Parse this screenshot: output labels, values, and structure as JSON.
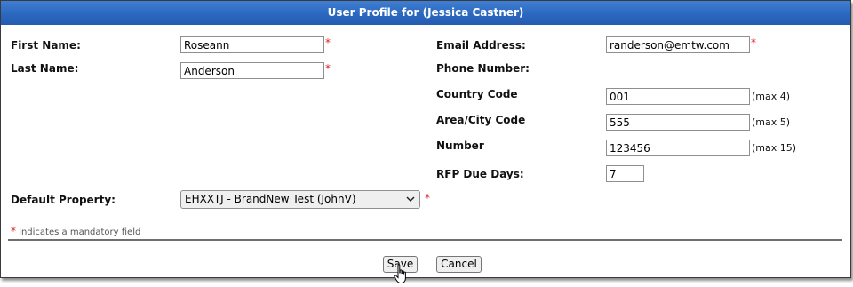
{
  "dialog": {
    "title": "User Profile for (Jessica Castner)"
  },
  "form": {
    "first_name": {
      "label": "First Name:",
      "value": "Roseann",
      "required_mark": "*"
    },
    "last_name": {
      "label": "Last Name:",
      "value": "Anderson",
      "required_mark": "*"
    },
    "email": {
      "label": "Email Address:",
      "value": "randerson@emtw.com",
      "required_mark": "*"
    },
    "phone": {
      "label": "Phone Number:",
      "country_code": {
        "label": "Country Code",
        "value": "001",
        "hint": "(max 4)"
      },
      "area_code": {
        "label": "Area/City Code",
        "value": "555",
        "hint": "(max 5)"
      },
      "number": {
        "label": "Number",
        "value": "123456",
        "hint": "(max 15)"
      }
    },
    "rfp_due_days": {
      "label": "RFP Due Days:",
      "value": "7"
    },
    "default_property": {
      "label": "Default Property:",
      "selected": "EHXXTJ - BrandNew Test (JohnV)",
      "required_mark": "*"
    },
    "mandatory_note": {
      "star": "*",
      "text": "indicates a mandatory field"
    }
  },
  "buttons": {
    "save_label": "Save",
    "cancel_label": "Cancel"
  },
  "icons": {
    "select_arrow": "chevron-down-icon",
    "cursor": "hand-pointer-icon"
  },
  "colors": {
    "title_bar": "#2c68c0",
    "required": "#e02020"
  }
}
